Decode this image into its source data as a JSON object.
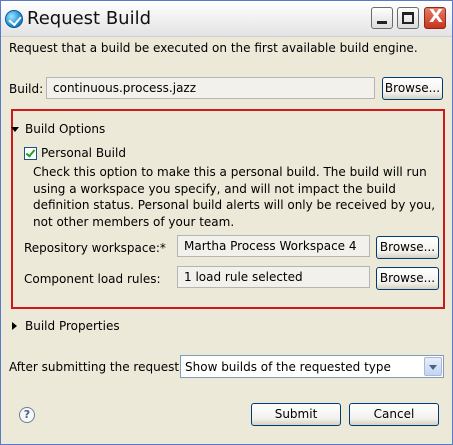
{
  "window": {
    "title": "Request Build",
    "controls": {
      "minimize": "_",
      "maximize": "□",
      "close": "X"
    }
  },
  "intro_text": "Request that a build be executed on the first available build engine.",
  "build": {
    "label": "Build:",
    "value": "continuous.process.jazz",
    "browse_label": "Browse..."
  },
  "build_options": {
    "section_label": "Build Options",
    "expanded": true,
    "personal_build": {
      "label": "Personal Build",
      "checked": true,
      "description": "Check this option to make this a personal build. The build will run using a workspace you specify, and will not impact the build definition status. Personal build alerts will only be received by you, not other members of your team."
    },
    "repository_workspace": {
      "label": "Repository workspace:*",
      "value": "Martha Process Workspace 4",
      "browse_label": "Browse..."
    },
    "component_load_rules": {
      "label": "Component load rules:",
      "value": "1 load rule selected",
      "browse_label": "Browse..."
    },
    "highlight_color": "#cc1a1a"
  },
  "build_properties": {
    "section_label": "Build Properties",
    "expanded": false
  },
  "after_submit": {
    "label": "After submitting the request:",
    "selected": "Show builds of the requested type"
  },
  "footer": {
    "help_glyph": "?",
    "submit_label": "Submit",
    "cancel_label": "Cancel"
  }
}
